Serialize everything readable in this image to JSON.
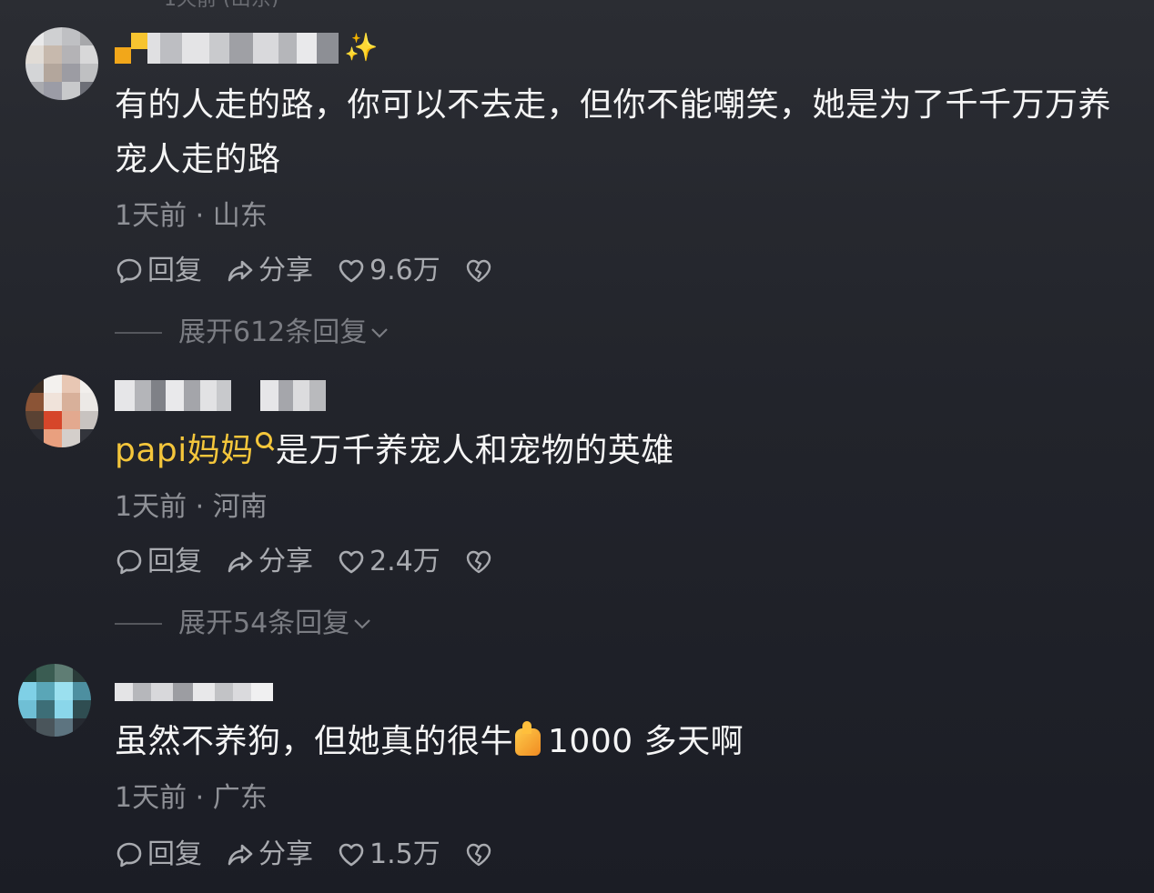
{
  "comments": [
    {
      "text": "有的人走的路，你可以不去走，但你不能嘲笑，她是为了千千万万养宠人走的路",
      "meta": "1天前 · 山东",
      "reply_label": "回复",
      "share_label": "分享",
      "likes": "9.6万",
      "expand_label": "展开612条回复"
    },
    {
      "mention": "papi妈妈",
      "text": "是万千养宠人和宠物的英雄",
      "meta": "1天前 · 河南",
      "reply_label": "回复",
      "share_label": "分享",
      "likes": "2.4万",
      "expand_label": "展开54条回复"
    },
    {
      "text_before_emoji": "虽然不养狗，但她真的很牛",
      "text_after_emoji": "1000 多天啊",
      "meta": "1天前 · 广东",
      "reply_label": "回复",
      "share_label": "分享",
      "likes": "1.5万"
    }
  ],
  "colors": {
    "mention": "#f4c63b",
    "meta": "#8f9197",
    "action": "#a9abb0"
  },
  "icons": [
    "comment-icon",
    "share-icon",
    "heart-icon",
    "broken-heart-icon",
    "chevron-down-icon",
    "sparkle-icon",
    "thumbs-up-emoji"
  ]
}
